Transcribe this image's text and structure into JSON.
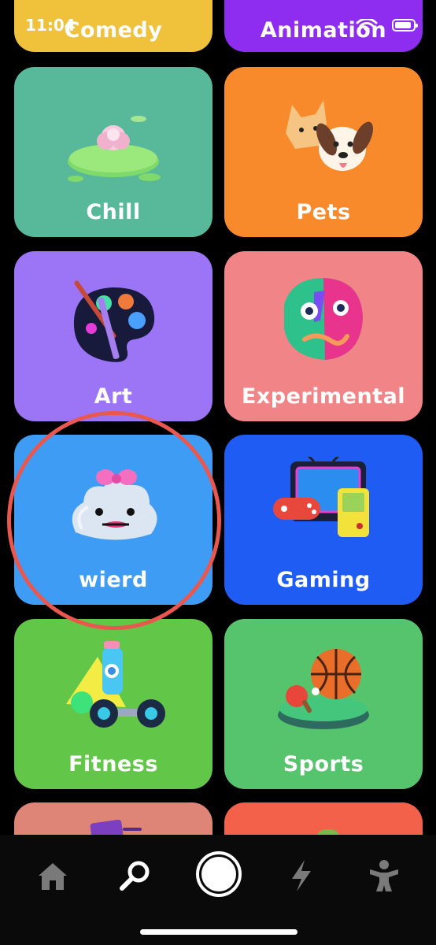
{
  "status_bar": {
    "time": "11:04"
  },
  "categories": [
    {
      "id": "comedy",
      "label": "Comedy",
      "color": "#f0c23b"
    },
    {
      "id": "animation",
      "label": "Animation",
      "color": "#8e2cf0"
    },
    {
      "id": "chill",
      "label": "Chill",
      "color": "#58b99a"
    },
    {
      "id": "pets",
      "label": "Pets",
      "color": "#f98a2c"
    },
    {
      "id": "art",
      "label": "Art",
      "color": "#9c75f7"
    },
    {
      "id": "experimental",
      "label": "Experimental",
      "color": "#f08486"
    },
    {
      "id": "wierd",
      "label": "wierd",
      "color": "#3e9cf5"
    },
    {
      "id": "gaming",
      "label": "Gaming",
      "color": "#1f5cf3"
    },
    {
      "id": "fitness",
      "label": "Fitness",
      "color": "#62c648"
    },
    {
      "id": "sports",
      "label": "Sports",
      "color": "#56c46d"
    },
    {
      "id": "row6-left",
      "label": "",
      "color": "#df8578"
    },
    {
      "id": "row6-right",
      "label": "",
      "color": "#f4614a"
    }
  ],
  "tab_bar": {
    "items": [
      "home-icon",
      "search-icon",
      "record-icon",
      "lightning-icon",
      "profile-icon"
    ],
    "active_color": "#ffffff",
    "inactive_color": "#7a7a7a"
  },
  "highlight_color": "#e9574f"
}
